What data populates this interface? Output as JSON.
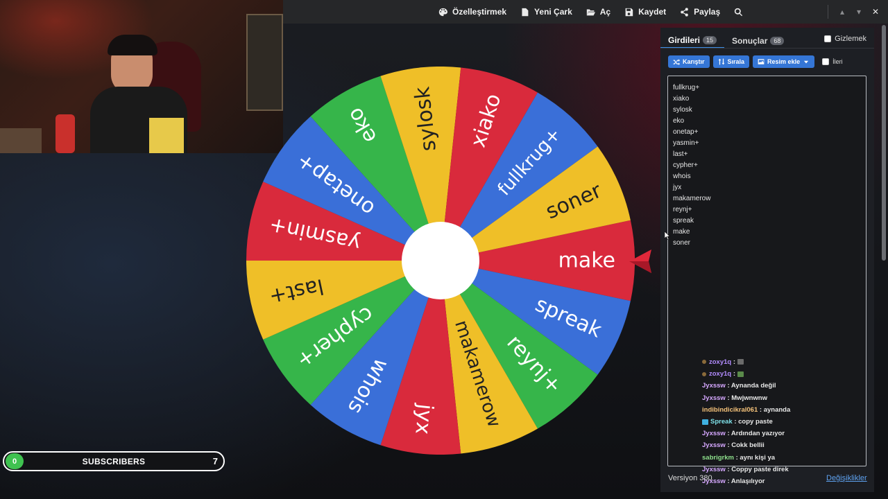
{
  "colors": {
    "accent": "#3576d6",
    "wheel_red": "#d92a3c",
    "wheel_yellow": "#efbf28",
    "wheel_green": "#36b54a",
    "wheel_blue": "#3a6fd8",
    "subscriber_green": "#3fc250"
  },
  "toolbar": {
    "items": [
      {
        "label": "Özelleştirmek",
        "icon": "palette-icon"
      },
      {
        "label": "Yeni Çark",
        "icon": "file-icon"
      },
      {
        "label": "Aç",
        "icon": "folder-open-icon"
      },
      {
        "label": "Kaydet",
        "icon": "save-icon"
      },
      {
        "label": "Paylaş",
        "icon": "share-icon"
      }
    ],
    "search_icon": "search-icon",
    "window_controls": {
      "up": "▴",
      "down": "▾",
      "close": "✕"
    }
  },
  "wheel": {
    "pointer_label": "make",
    "segments": [
      {
        "label": "make",
        "color": "red"
      },
      {
        "label": "spreak",
        "color": "blue"
      },
      {
        "label": "reynj+",
        "color": "green"
      },
      {
        "label": "makamerow",
        "color": "yellow"
      },
      {
        "label": "jyx",
        "color": "red"
      },
      {
        "label": "whois",
        "color": "blue"
      },
      {
        "label": "cypher+",
        "color": "green"
      },
      {
        "label": "last+",
        "color": "yellow"
      },
      {
        "label": "yasmin+",
        "color": "red"
      },
      {
        "label": "onetap+",
        "color": "blue"
      },
      {
        "label": "eko",
        "color": "green"
      },
      {
        "label": "sylosk",
        "color": "yellow"
      },
      {
        "label": "xiako",
        "color": "red"
      },
      {
        "label": "fullkrug+",
        "color": "blue"
      },
      {
        "label": "soner",
        "color": "yellow"
      }
    ]
  },
  "panel": {
    "tabs": [
      {
        "label": "Girdileri",
        "count": "15"
      },
      {
        "label": "Sonuçlar",
        "count": "68"
      }
    ],
    "hide_label": "Gizlemek",
    "buttons": {
      "shuffle": "Karıştır",
      "sort": "Sırala",
      "add_image": "Resim ekle"
    },
    "advanced_label": "İleri",
    "entries": [
      "fullkrug+",
      "xiako",
      "sylosk",
      "eko",
      "onetap+",
      "yasmin+",
      "last+",
      "cypher+",
      "whois",
      "jyx",
      "makamerow",
      "reynj+",
      "spreak",
      "make",
      "soner"
    ],
    "version": "Versiyon 380",
    "changes": "Değişiklikler"
  },
  "chat": [
    {
      "user": "zoxy1q",
      "text": "",
      "style": "u1",
      "badge": true,
      "emote": "grey"
    },
    {
      "user": "zoxy1q",
      "text": "",
      "style": "u1",
      "badge": true,
      "emote": "green"
    },
    {
      "user": "Jyxssw",
      "text": "Aynanda değil",
      "style": "u2"
    },
    {
      "user": "Jyxssw",
      "text": "Mwjwnwnw",
      "style": "u2"
    },
    {
      "user": "indibindicikral061",
      "text": "aynanda",
      "style": "u3"
    },
    {
      "user": "Spreak",
      "text": "copy paste",
      "style": "u4",
      "icons": true
    },
    {
      "user": "Jyxssw",
      "text": "Ardından yazıyor",
      "style": "u2"
    },
    {
      "user": "Jyxssw",
      "text": "Cokk bellii",
      "style": "u2"
    },
    {
      "user": "sabrigrkm",
      "text": "aynı kişi ya",
      "style": "u5"
    },
    {
      "user": "Jyxssw",
      "text": "Coppy paste direk",
      "style": "u2"
    },
    {
      "user": "Jyxssw",
      "text": "Anlaşılıyor",
      "style": "u2"
    }
  ],
  "subscribers": {
    "current": "0",
    "label": "SUBSCRIBERS",
    "goal": "7",
    "progress_fraction": 0
  }
}
